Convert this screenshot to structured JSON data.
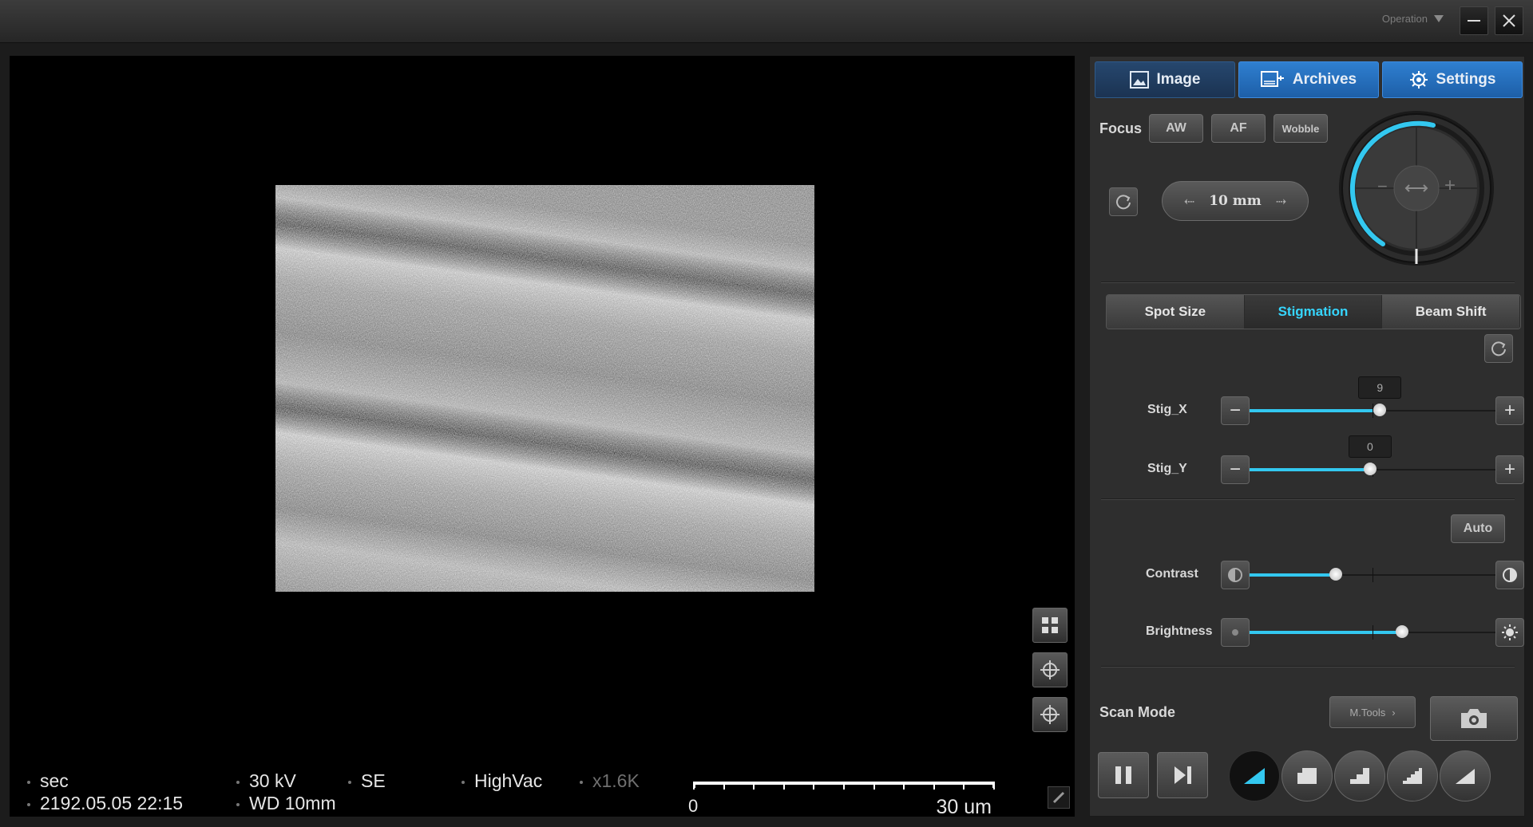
{
  "titlebar": {
    "menu_label": "Operation"
  },
  "viewer": {
    "status": {
      "signal_mode": "sec",
      "datetime": "2192.05.05 22:15",
      "voltage": "30 kV",
      "working_distance": "WD 10mm",
      "detector": "SE",
      "vacuum": "HighVac",
      "magnification": "x1.6K",
      "scale_zero": "0",
      "scale_label": "30 um"
    }
  },
  "panel": {
    "tabs": [
      {
        "label": "Image",
        "icon": "image-icon",
        "active": true
      },
      {
        "label": "Archives",
        "icon": "archives-icon",
        "active": false
      },
      {
        "label": "Settings",
        "icon": "gear-icon",
        "active": false
      }
    ],
    "focus": {
      "label": "Focus",
      "aw_label": "AW",
      "af_label": "AF",
      "wobble_label": "Wobble",
      "value": "10 mm",
      "knob_minus": "−",
      "knob_plus": "+"
    },
    "segments": [
      {
        "label": "Spot Size",
        "active": false
      },
      {
        "label": "Stigmation",
        "active": true
      },
      {
        "label": "Beam Shift",
        "active": false
      }
    ],
    "stig_x": {
      "label": "Stig_X",
      "value": "9",
      "level": 0.53
    },
    "stig_y": {
      "label": "Stig_Y",
      "value": "0",
      "level": 0.49
    },
    "auto_label": "Auto",
    "contrast": {
      "label": "Contrast",
      "level": 0.35
    },
    "brightness": {
      "label": "Brightness",
      "level": 0.62
    },
    "scan_mode_label": "Scan Mode",
    "mtools_label": "M.Tools",
    "accent_color": "#33c8f0"
  }
}
